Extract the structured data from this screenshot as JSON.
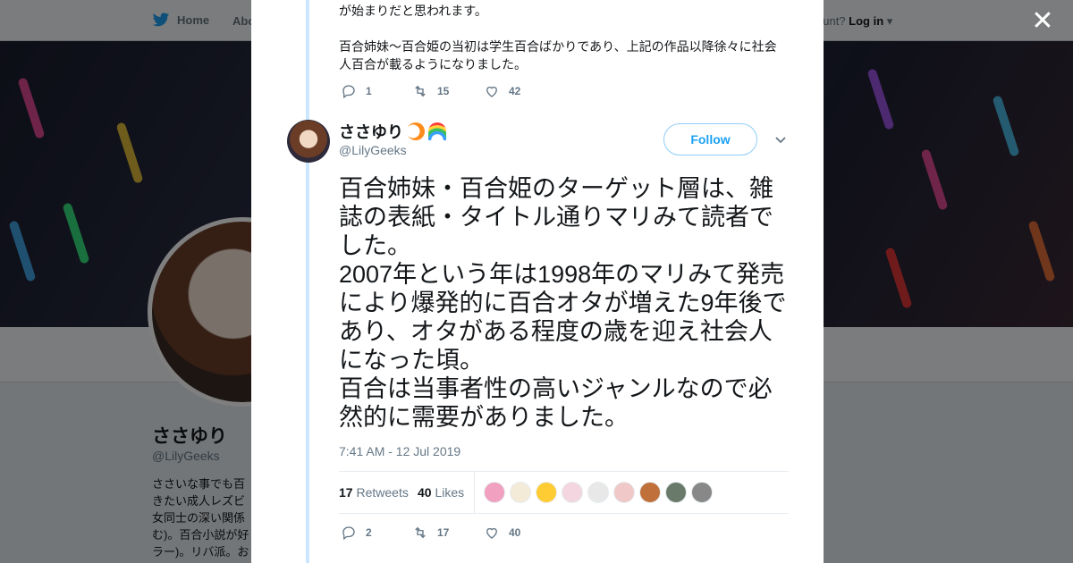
{
  "topbar": {
    "home_label": "Home",
    "about_label": "Abo",
    "account_prompt": "ccount?",
    "login_label": "Log in"
  },
  "background_profile": {
    "name": "ささゆり",
    "handle": "@LilyGeeks",
    "bio": "ささいな事でも百きたい成人レズビ女同士の深い関係む)。百合小説が好ラー)。リバ派。お"
  },
  "previous_tweet": {
    "text": "が始まりだと思われます。\n\n百合姉妹〜百合姫の当初は学生百合ばかりであり、上記の作品以降徐々に社会人百合が載るようになりました。",
    "replies": "1",
    "retweets": "15",
    "likes": "42"
  },
  "tweet": {
    "name": "ささゆり",
    "handle": "@LilyGeeks",
    "follow_label": "Follow",
    "text": "百合姉妹・百合姫のターゲット層は、雑誌の表紙・タイトル通りマリみて読者でした。\n2007年という年は1998年のマリみて発売により爆発的に百合オタが増えた9年後であり、オタがある程度の歳を迎え社会人になった頃。\n百合は当事者性の高いジャンルなので必然的に需要がありました。",
    "timestamp": "7:41 AM - 12 Jul 2019",
    "retweet_count": "17",
    "retweets_label": "Retweets",
    "like_count": "40",
    "likes_label": "Likes",
    "replies": "2",
    "retweets": "17",
    "likes": "40"
  },
  "colors": {
    "accent": "#1da1f2",
    "thread_line": "#cbe6ff"
  }
}
